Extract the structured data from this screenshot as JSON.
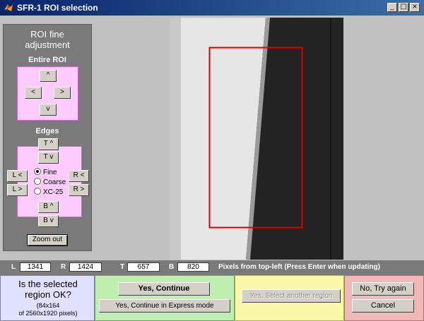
{
  "window": {
    "title": "SFR-1 ROI selection"
  },
  "panel": {
    "title_line1": "ROI fine",
    "title_line2": "adjustment",
    "entire_roi_label": "Entire ROI",
    "up": "^",
    "left": "<",
    "right": ">",
    "down": "v",
    "edges_label": "Edges",
    "top_up": "T  ^",
    "top_down": "T  v",
    "left_left": "L  <",
    "left_right": "L  >",
    "right_left": "R  <",
    "right_right": "R  >",
    "bottom_up": "B  ^",
    "bottom_down": "B  v",
    "radio_fine": "Fine",
    "radio_coarse": "Coarse",
    "radio_xc25": "XC-25",
    "zoom_out": "Zoom out"
  },
  "coords": {
    "l_label": "L",
    "l_value": "1341",
    "r_label": "R",
    "r_value": "1424",
    "t_label": "T",
    "t_value": "657",
    "b_label": "B",
    "b_value": "820",
    "hint": "Pixels from top-left  (Press Enter when updating)"
  },
  "footer": {
    "question_line1": "Is the selected",
    "question_line2": "region OK?",
    "size_line1": "(84x164",
    "size_line2": "of 2560x1920 pixels)",
    "yes_continue": "Yes, Continue",
    "yes_express": "Yes, Continue in Express mode",
    "yes_select_another": "Yes, Select another region",
    "no_try_again": "No, Try again",
    "cancel": "Cancel"
  },
  "colors": {
    "roi_rect": "#e00000",
    "roi_inner": "#00c8c8",
    "question_bg": "#e0e0ff",
    "green_bg": "#c0f0b0",
    "yellow_bg": "#f8f8a8",
    "red_bg": "#f0b8b8"
  }
}
